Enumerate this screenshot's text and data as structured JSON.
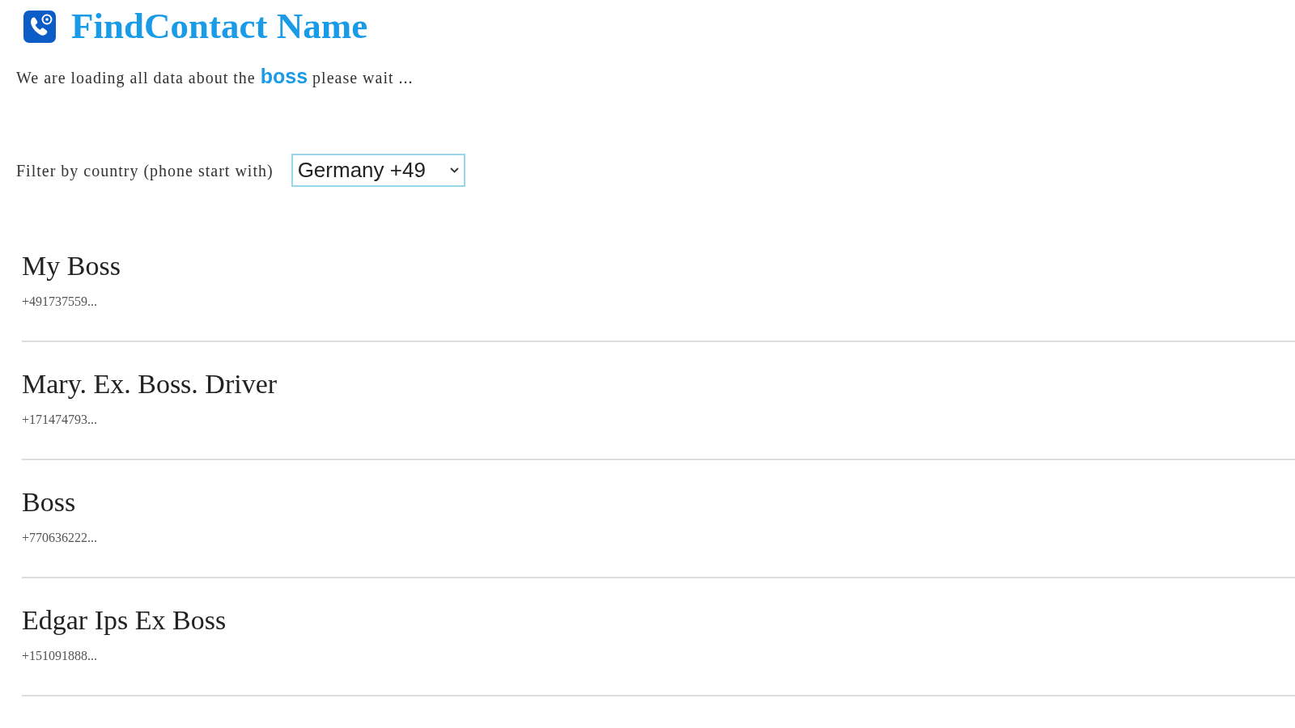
{
  "header": {
    "title": "FindContact Name",
    "subtitle": {
      "before": "We are loading all data about the",
      "keyword": "boss",
      "after": "please wait ..."
    }
  },
  "filter": {
    "label": "Filter by country (phone start with)",
    "value": "Germany +49"
  },
  "contacts": [
    {
      "name": "My Boss",
      "phone": "+491737559..."
    },
    {
      "name": "Mary. Ex. Boss. Driver",
      "phone": "+171474793..."
    },
    {
      "name": "Boss",
      "phone": "+770636222..."
    },
    {
      "name": "Edgar Ips Ex Boss",
      "phone": "+151091888..."
    }
  ]
}
